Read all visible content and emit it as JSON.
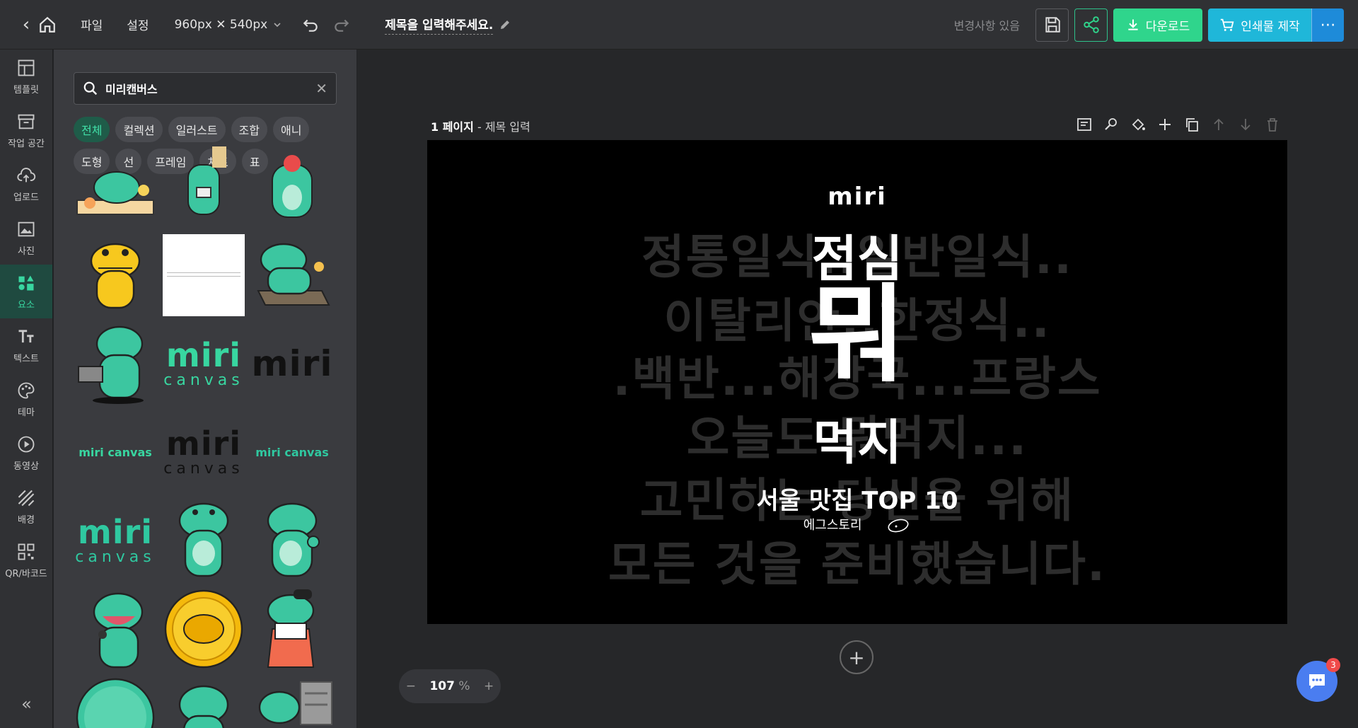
{
  "topbar": {
    "menu_file": "파일",
    "menu_settings": "설정",
    "canvas_size": "960px ✕ 540px",
    "title": "제목을 입력해주세요.",
    "changes_status": "변경사항 있음",
    "download_label": "다운로드",
    "print_label": "인쇄물 제작"
  },
  "sidebar": {
    "items": [
      {
        "label": "템플릿",
        "icon": "template-icon"
      },
      {
        "label": "작업 공간",
        "icon": "workspace-icon"
      },
      {
        "label": "업로드",
        "icon": "upload-icon"
      },
      {
        "label": "사진",
        "icon": "photo-icon"
      },
      {
        "label": "요소",
        "icon": "elements-icon"
      },
      {
        "label": "텍스트",
        "icon": "text-icon"
      },
      {
        "label": "테마",
        "icon": "palette-icon"
      },
      {
        "label": "동영상",
        "icon": "video-icon"
      },
      {
        "label": "배경",
        "icon": "background-icon"
      },
      {
        "label": "QR/바코드",
        "icon": "qr-icon"
      }
    ],
    "collapse": "«"
  },
  "panel": {
    "search_value": "미리캔버스",
    "chips": [
      "전체",
      "컬렉션",
      "일러스트",
      "조합",
      "애니",
      "도형",
      "선",
      "프레임",
      "차트",
      "표"
    ],
    "logo_text": "miri",
    "logo_sub": "canvas",
    "wordmark": "miri canvas"
  },
  "canvas": {
    "page_number": "1 페이지",
    "page_title_placeholder": "- 제목 입력",
    "slide": {
      "logo": "miri",
      "bg_lines": [
        "정통일식..일반일식..",
        "이탈리안..한정식..",
        ".백반...해장국...프랑스",
        "오늘도 뭐먹지...",
        "고민하는 당신을 위해",
        "모든 것을 준비했습니다."
      ],
      "headline_top": "점심",
      "headline_mid": "뭐",
      "headline_bottom": "먹지",
      "subtitle": "서울 맛집 TOP 10",
      "author": "에그스토리"
    },
    "zoom_value": "107",
    "zoom_unit": "%",
    "chat_badge": "3"
  },
  "colors": {
    "accent": "#2fd58c",
    "print": "#1fb7d9",
    "active_side": "#38d6a0"
  }
}
